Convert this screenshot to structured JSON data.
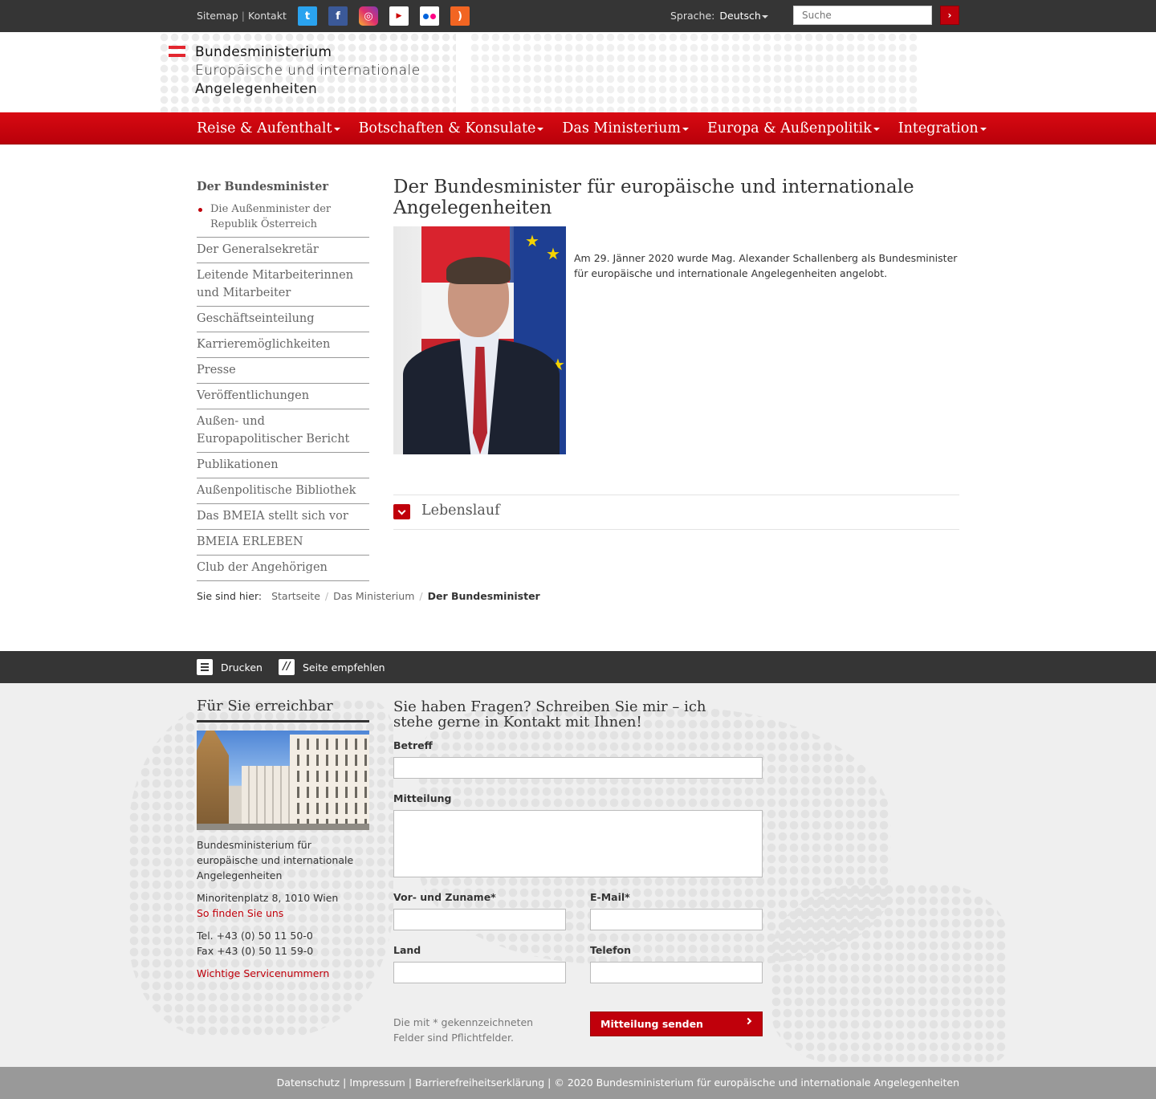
{
  "topbar": {
    "sitemap": "Sitemap",
    "kontakt": "Kontakt",
    "social": [
      "twitter-icon",
      "facebook-icon",
      "instagram-icon",
      "youtube-icon",
      "flickr-icon",
      "rss-icon"
    ],
    "language_label": "Sprache:",
    "language_value": "Deutsch",
    "search_placeholder": "Suche"
  },
  "logo": {
    "line1": "Bundesministerium",
    "line2": "Europäische und internationale",
    "line3": "Angelegenheiten"
  },
  "mainnav": [
    "Reise & Aufenthalt",
    "Botschaften & Konsulate",
    "Das Ministerium",
    "Europa & Außenpolitik",
    "Integration"
  ],
  "sidenav": {
    "head": "Der Bundesminister",
    "sub": "Die Außenminister der Republik Österreich",
    "items": [
      "Der Generalsekretär",
      "Leitende Mitarbeiterinnen und Mitarbeiter",
      "Geschäftseinteilung",
      "Karrieremöglichkeiten",
      "Presse",
      "Veröffentlichungen",
      "Außen- und Europapolitischer Bericht",
      "Publikationen",
      "Außenpolitische Bibliothek",
      "Das BMEIA stellt sich vor",
      "BMEIA ERLEBEN",
      "Club der Angehörigen"
    ]
  },
  "article": {
    "title": "Der Bundesminister für europäische und internationale Angelegenheiten",
    "intro": "Am 29. Jänner 2020 wurde Mag. Alexander Schallenberg als Bundesminister für europäische und internationale Angelegenheiten angelobt.",
    "accordion_label": "Lebenslauf"
  },
  "breadcrumb": {
    "lead": "Sie sind hier:",
    "items": [
      "Startseite",
      "Das Ministerium"
    ],
    "current": "Der Bundesminister"
  },
  "toolbar": {
    "print": "Drucken",
    "recommend": "Seite empfehlen"
  },
  "contact": {
    "heading": "Für Sie erreichbar",
    "org": "Bundesministerium für europäische und internationale Angelegenheiten",
    "address": "Minoritenplatz 8, 1010 Wien",
    "directions": "So finden Sie uns",
    "tel": "Tel. +43 (0) 50 11 50-0",
    "fax": "Fax +43 (0) 50 11 59-0",
    "service": "Wichtige Servicenummern"
  },
  "form": {
    "heading": "Sie haben Fragen? Schreiben Sie mir – ich stehe gerne in Kontakt mit Ihnen!",
    "subject_label": "Betreff",
    "message_label": "Mitteilung",
    "name_label": "Vor- und Zuname*",
    "email_label": "E-Mail*",
    "country_label": "Land",
    "phone_label": "Telefon",
    "note": "Die mit * gekennzeichneten Felder sind Pflichtfelder.",
    "submit": "Mitteilung senden"
  },
  "bottombar": {
    "links": [
      "Datenschutz",
      "Impressum",
      "Barrierefreiheitserklärung"
    ],
    "copyright": "© 2020 Bundesministerium für europäische und internationale Angelegenheiten"
  },
  "colors": {
    "brand_red": "#c0000b",
    "dark_bar": "#353535",
    "footer_bg": "#efefef"
  }
}
